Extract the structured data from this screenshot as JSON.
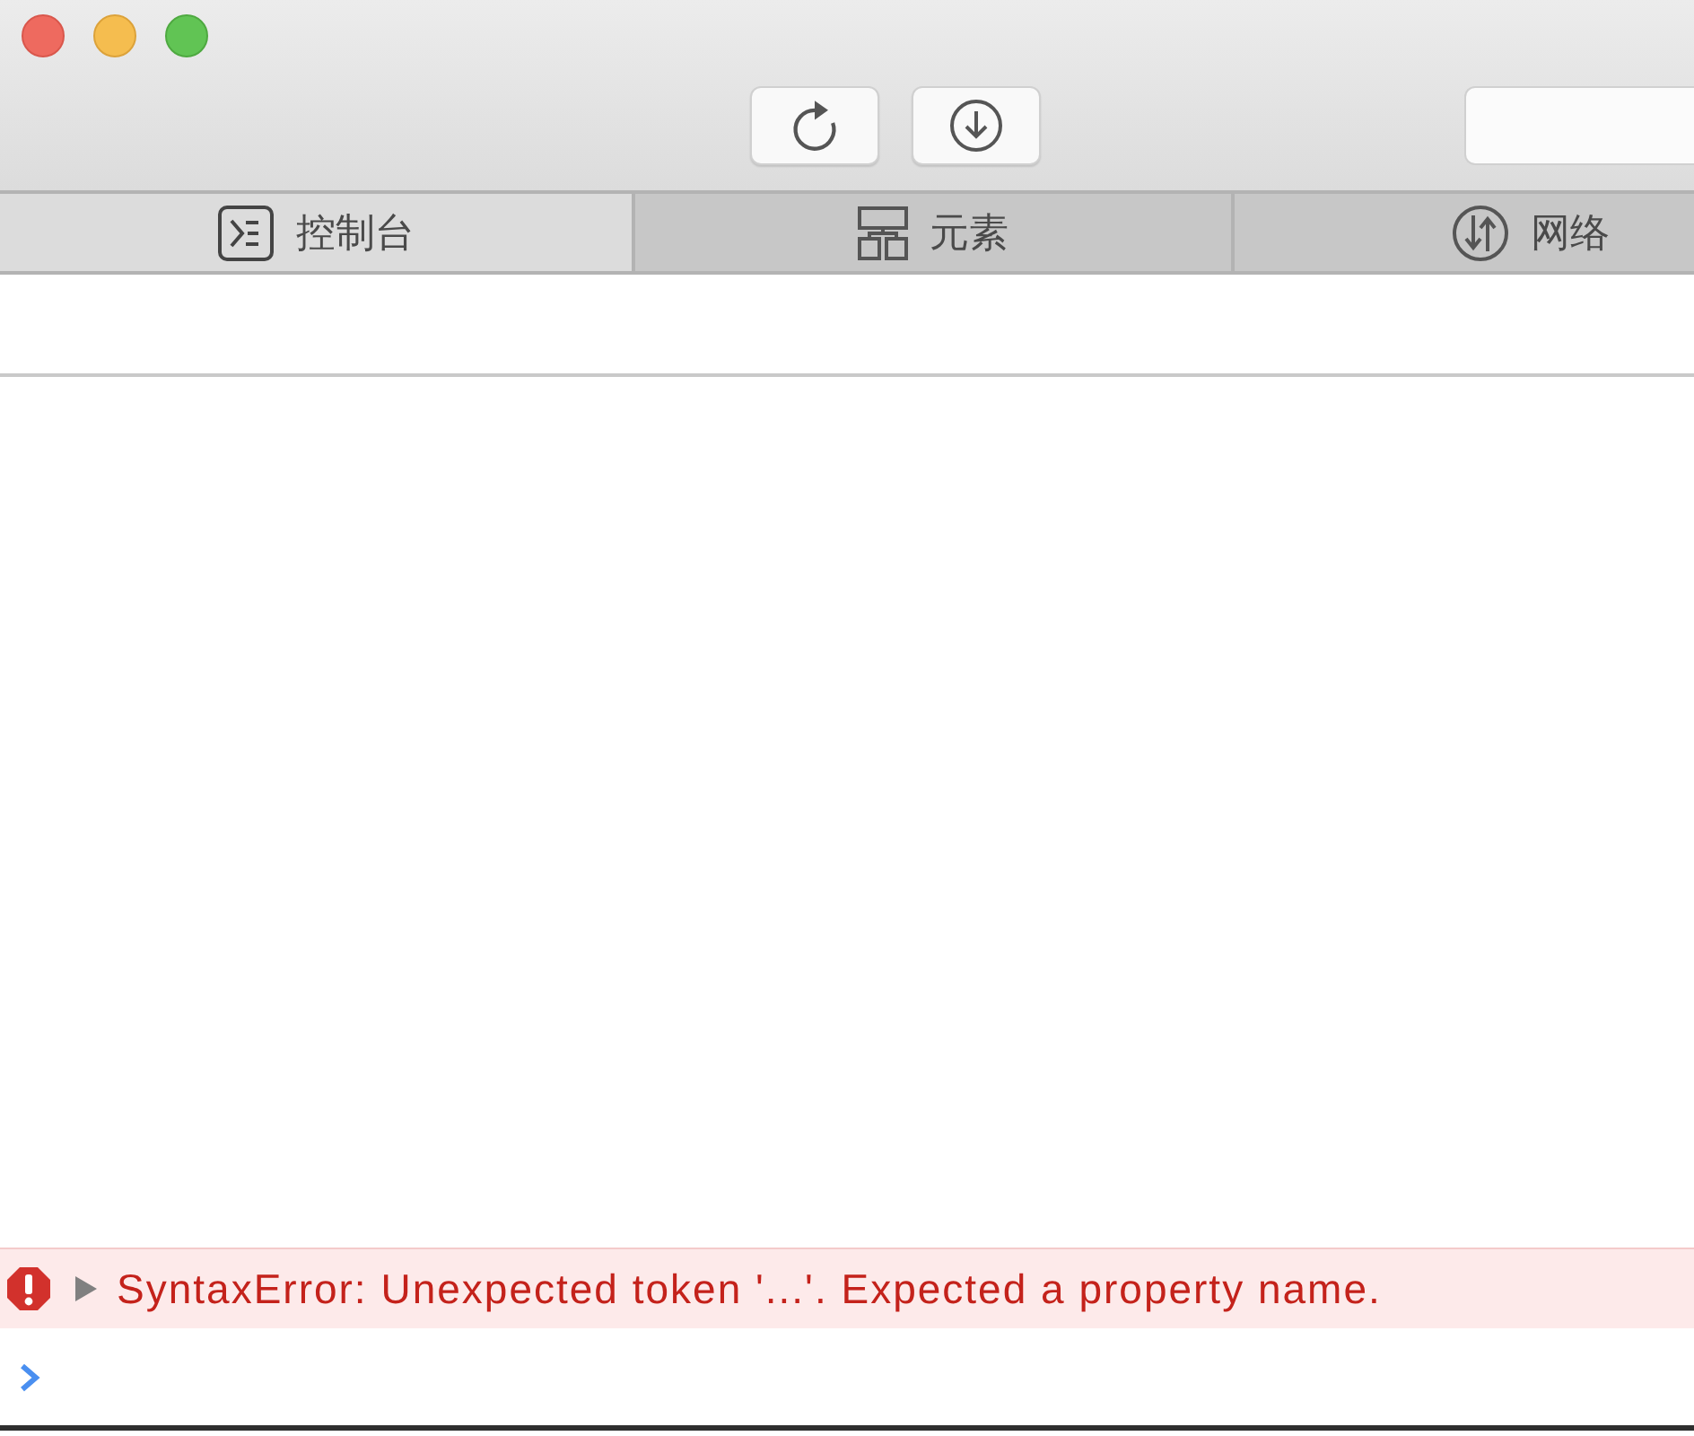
{
  "tabs": [
    {
      "label": "控制台",
      "selected": true
    },
    {
      "label": "元素",
      "selected": false
    },
    {
      "label": "网络",
      "selected": false
    }
  ],
  "console": {
    "messages": [
      {
        "kind": "error",
        "expanded": false,
        "text": "SyntaxError: Unexpected token '...'. Expected a property name."
      }
    ]
  }
}
